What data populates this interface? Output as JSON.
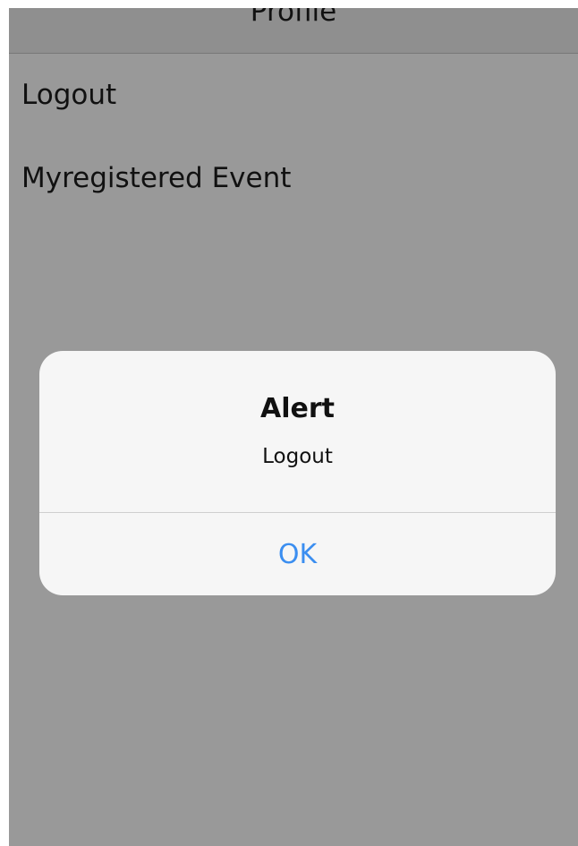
{
  "navbar": {
    "title": "Profile"
  },
  "menu": {
    "items": [
      {
        "label": "Logout"
      },
      {
        "label": "Myregistered Event"
      }
    ]
  },
  "alert": {
    "title": "Alert",
    "message": "Logout",
    "ok_label": "OK"
  },
  "colors": {
    "background_dimmed": "#999999",
    "alert_background": "#f6f6f6",
    "button_blue": "#3b8ef0"
  }
}
